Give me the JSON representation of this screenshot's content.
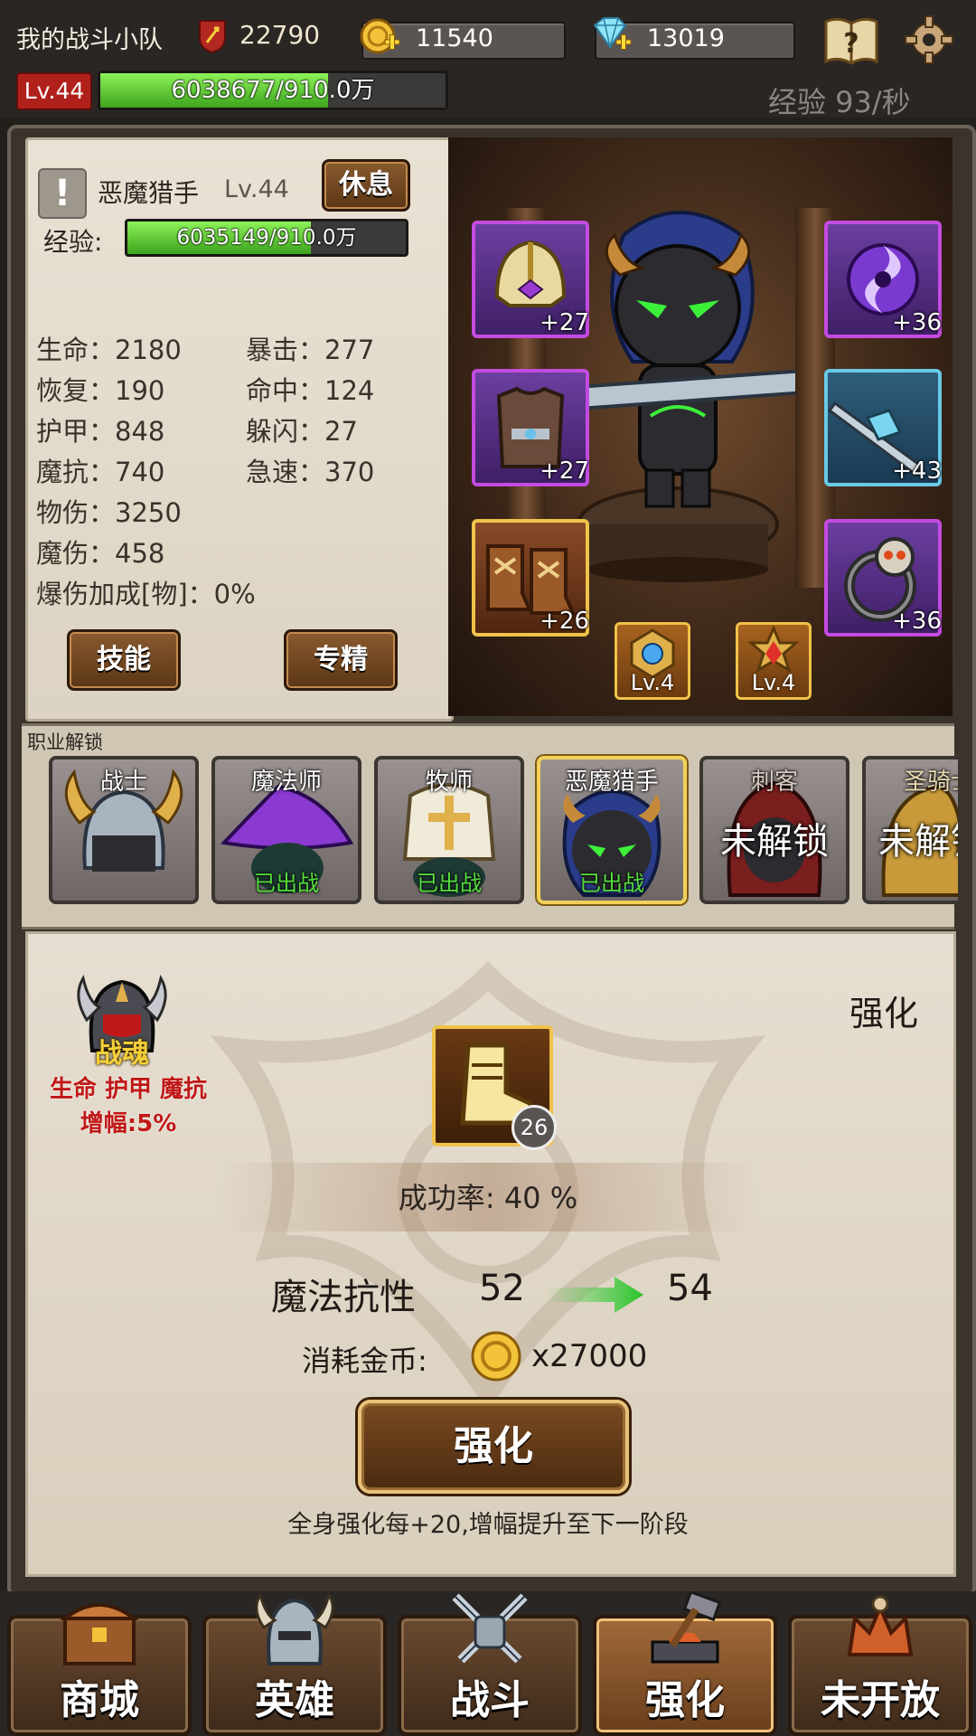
{
  "header": {
    "team_name": "我的战斗小队",
    "power": "22790",
    "gold": "11540",
    "gems": "13019",
    "level": "Lv.44",
    "xp_text": "6038677/910.0万",
    "xp_fraction": 0.66,
    "xp_rate": "经验 93/秒"
  },
  "hero": {
    "alert_icon": "!",
    "name": "恶魔猎手",
    "level": "Lv.44",
    "rest_label": "休息",
    "exp_label": "经验:",
    "exp_text": "6035149/910.0万",
    "exp_fraction": 0.66,
    "stats_left": [
      "生命：2180",
      "恢复：190",
      "护甲：848",
      "魔抗：740",
      "物伤：3250",
      "魔伤：458",
      "爆伤加成[物]：0%"
    ],
    "stats_right": [
      "暴击：277",
      "命中：124",
      "躲闪：27",
      "急速：370"
    ],
    "skill_label": "技能",
    "spec_label": "专精"
  },
  "equipment": [
    {
      "slot": "helmet",
      "plus": "+27"
    },
    {
      "slot": "amulet",
      "plus": "+36"
    },
    {
      "slot": "armor",
      "plus": "+27"
    },
    {
      "slot": "weapon",
      "plus": "+43"
    },
    {
      "slot": "boots",
      "plus": "+26"
    },
    {
      "slot": "ring",
      "plus": "+36"
    }
  ],
  "gems": [
    {
      "icon": "blue-gem-icon",
      "level": "Lv.4"
    },
    {
      "icon": "red-gem-icon",
      "level": "Lv.4"
    }
  ],
  "classes": {
    "title": "职业解锁",
    "items": [
      {
        "name": "战士",
        "status": ""
      },
      {
        "name": "魔法师",
        "status": "已出战"
      },
      {
        "name": "牧师",
        "status": "已出战"
      },
      {
        "name": "恶魔猎手",
        "status": "已出战"
      },
      {
        "name": "刺客",
        "status": "未解锁"
      },
      {
        "name": "圣骑士",
        "status": "未解锁"
      }
    ]
  },
  "enhance": {
    "tab_label": "强化",
    "soul_name": "战魂",
    "soul_desc": "生命 护甲 魔抗 增幅:5%",
    "item_count": "26",
    "success_rate": "成功率: 40 %",
    "attr_name": "魔法抗性",
    "attr_old": "52",
    "attr_new": "54",
    "cost_label": "消耗金币:",
    "cost_value": "x27000",
    "button_label": "强化",
    "tip": "全身强化每+20,增幅提升至下一阶段"
  },
  "nav": [
    {
      "label": "商城"
    },
    {
      "label": "英雄"
    },
    {
      "label": "战斗"
    },
    {
      "label": "强化"
    },
    {
      "label": "未开放"
    }
  ],
  "colors": {
    "xp_green": "#5ec83a",
    "equip_purple": "#c44be0",
    "equip_blue": "#69c9e6",
    "equip_gold": "#f0c24a",
    "soul_red": "#c01818",
    "status_green": "#54e03c"
  }
}
